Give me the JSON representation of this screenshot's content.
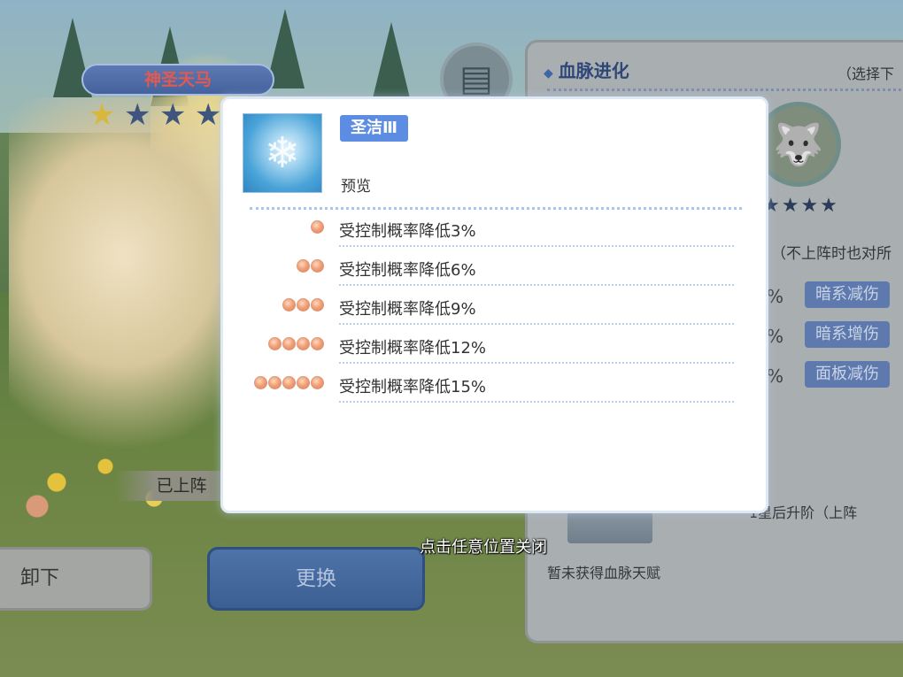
{
  "character": {
    "name": "神圣天马",
    "stars_filled": 1,
    "stars_total": 5,
    "deployed_label": "已上阵"
  },
  "buttons": {
    "unload": "卸下",
    "change": "更换"
  },
  "bloodline_panel": {
    "title": "血脉进化",
    "hint": "（选择下",
    "note": "（不上阵时也对所",
    "stats": [
      {
        "pct": "%",
        "tag": "暗系减伤"
      },
      {
        "pct": "%",
        "tag": "暗系增伤"
      },
      {
        "pct": "%",
        "tag": "面板减伤"
      }
    ],
    "upgrade_note": "1星后升阶（上阵",
    "not_obtained": "暂未获得血脉天赋"
  },
  "popup": {
    "skill_name": "圣洁Ⅲ",
    "preview_label": "预览",
    "tiers": [
      {
        "orbs": 1,
        "text": "受控制概率降低3%"
      },
      {
        "orbs": 2,
        "text": "受控制概率降低6%"
      },
      {
        "orbs": 3,
        "text": "受控制概率降低9%"
      },
      {
        "orbs": 4,
        "text": "受控制概率降低12%"
      },
      {
        "orbs": 5,
        "text": "受控制概率降低15%"
      }
    ]
  },
  "close_hint": "点击任意位置关闭",
  "colors": {
    "tag_blue": "#5d8ce3",
    "orb": "#e07c55",
    "dotted_line": "#a9c4ee"
  }
}
